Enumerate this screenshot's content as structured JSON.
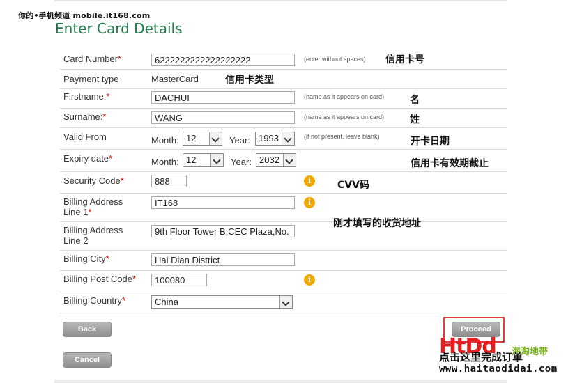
{
  "watermark_top": "你的•手机频道 mobile.it168.com",
  "page_title": "Enter Card Details",
  "form": {
    "card_number": {
      "label": "Card Number",
      "value": "6222222222222222222",
      "hint": "(enter without spaces)"
    },
    "payment_type": {
      "label": "Payment type",
      "value": "MasterCard"
    },
    "firstname": {
      "label": "Firstname:",
      "value": "DACHUI",
      "hint": "(name as it appears on card)"
    },
    "surname": {
      "label": "Surname:",
      "value": "WANG",
      "hint": "(name as it appears on card)"
    },
    "valid_from": {
      "label": "Valid From",
      "month_label": "Month:",
      "month": "12",
      "year_label": "Year:",
      "year": "1993",
      "hint": "(if not present, leave blank)"
    },
    "expiry": {
      "label": "Expiry date",
      "month_label": "Month:",
      "month": "12",
      "year_label": "Year:",
      "year": "2032"
    },
    "security_code": {
      "label": "Security Code",
      "value": "888"
    },
    "address1": {
      "label1": "Billing Address",
      "label2": "Line 1",
      "value": "IT168"
    },
    "address2": {
      "label1": "Billing Address",
      "label2": "Line 2",
      "value": "9th Floor Tower B,CEC Plaza,No."
    },
    "city": {
      "label": "Billing City",
      "value": "Hai Dian District"
    },
    "postcode": {
      "label": "Billing Post Code",
      "value": "100080"
    },
    "country": {
      "label": "Billing Country",
      "value": "China"
    }
  },
  "required_mark": "*",
  "info_glyph": "i",
  "buttons": {
    "back": "Back",
    "cancel": "Cancel",
    "proceed": "Proceed"
  },
  "annotations": {
    "card_number": "信用卡号",
    "payment_type": "信用卡类型",
    "firstname": "名",
    "surname": "姓",
    "valid_from": "开卡日期",
    "expiry": "信用卡有效期截止",
    "cvv": "CVV码",
    "address": "刚才填写的收货地址",
    "click_here": "点击这里完成订单"
  },
  "logo": {
    "text": "HtDd",
    "cn": "海淘地带",
    "site": "www.haitaodidai.com"
  },
  "colors": {
    "title_green": "#1e7a4a",
    "required_red": "#cc0000",
    "info_orange": "#f0a800",
    "highlight_red": "#e23b3b",
    "logo_red": "#e21e1e",
    "logo_green": "#7ab317"
  }
}
